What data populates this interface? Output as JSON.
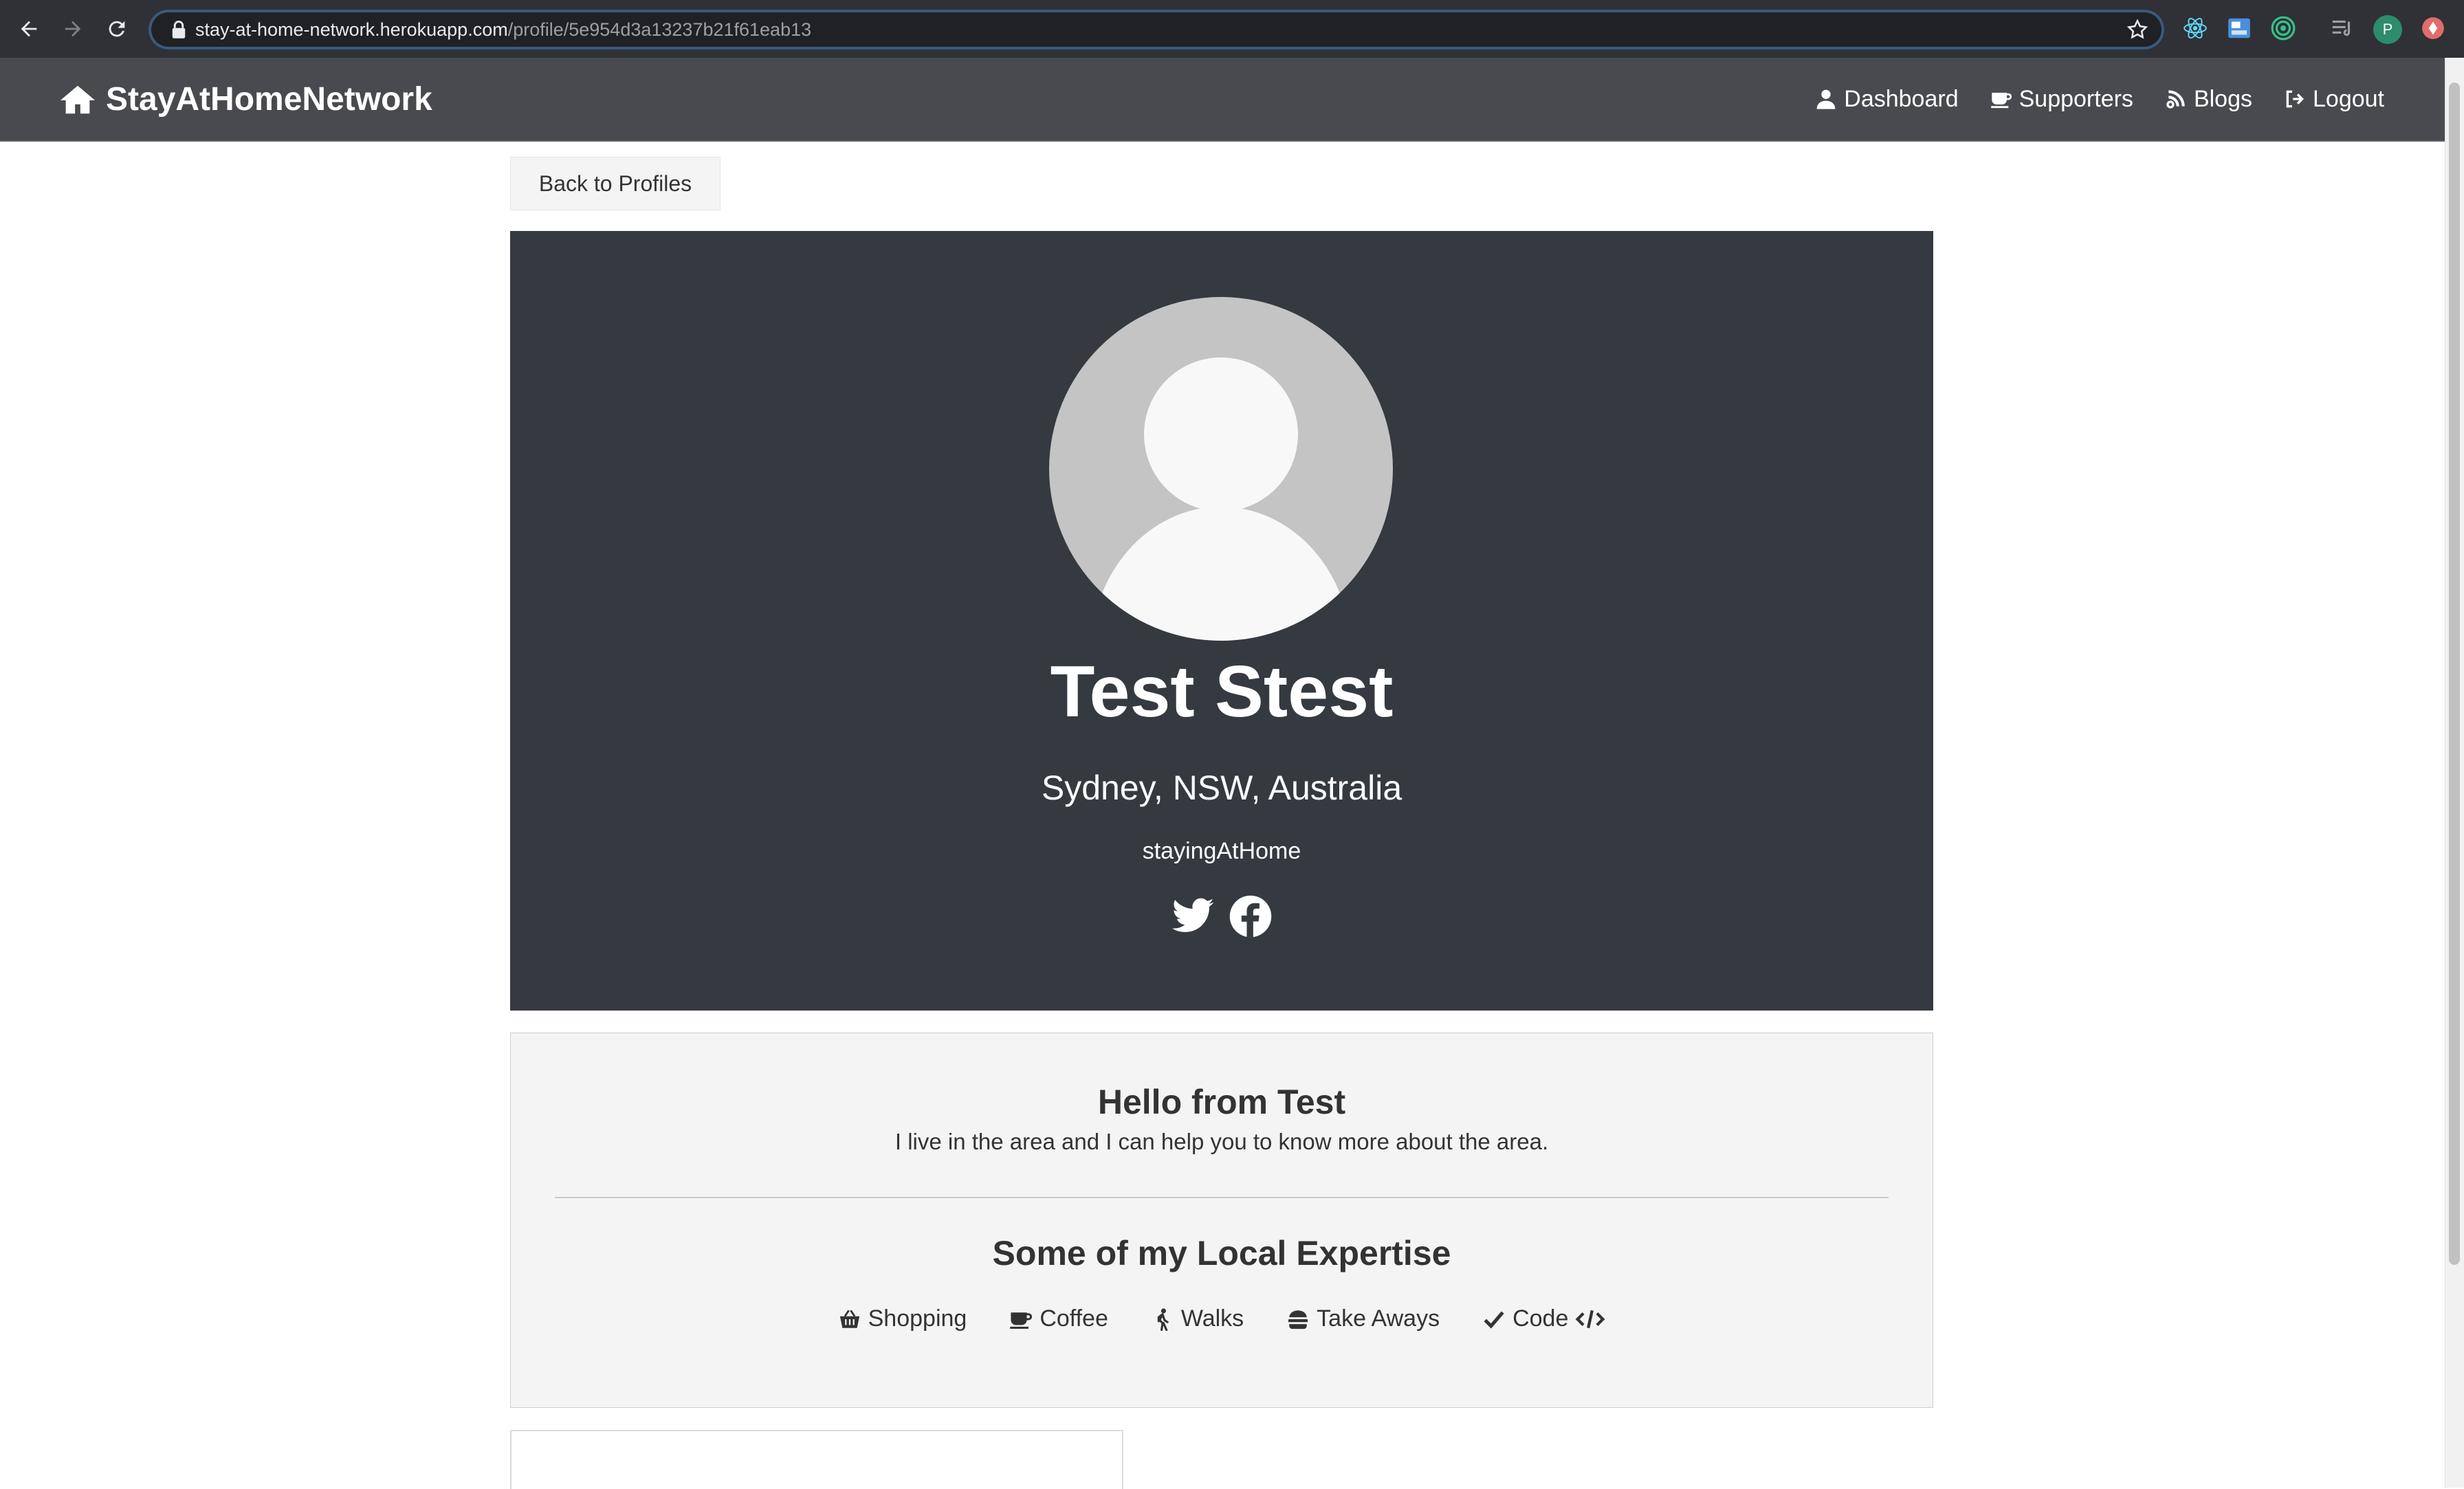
{
  "browser": {
    "url_host": "stay-at-home-network.herokuapp.com",
    "url_path": "/profile/5e954d3a13237b21f61eab13",
    "profile_initial": "P"
  },
  "navbar": {
    "brand": "StayAtHomeNetwork",
    "links": [
      {
        "label": "Dashboard",
        "icon": "user-icon"
      },
      {
        "label": "Supporters",
        "icon": "coffee-icon"
      },
      {
        "label": "Blogs",
        "icon": "blog-icon"
      },
      {
        "label": "Logout",
        "icon": "logout-icon"
      }
    ]
  },
  "back_button": {
    "label": "Back to Profiles"
  },
  "profile": {
    "name": "Test Stest",
    "location": "Sydney, NSW, Australia",
    "status": "stayingAtHome",
    "social": [
      "twitter-icon",
      "facebook-icon"
    ]
  },
  "about": {
    "title": "Hello from Test",
    "bio": "I live in the area and I can help you to know more about the area.",
    "skills_title": "Some of my Local Expertise",
    "skills": [
      {
        "label": "Shopping",
        "icon": "basket-icon"
      },
      {
        "label": "Coffee",
        "icon": "coffee-icon"
      },
      {
        "label": "Walks",
        "icon": "walking-icon"
      },
      {
        "label": "Take Aways",
        "icon": "hamburger-icon"
      },
      {
        "label": "Code",
        "icon": "check-icon",
        "trailing_icon": "code-icon"
      }
    ]
  },
  "colors": {
    "navbar": "#494a4f",
    "profile_top": "#353a40",
    "about_bg": "#f4f4f4"
  }
}
